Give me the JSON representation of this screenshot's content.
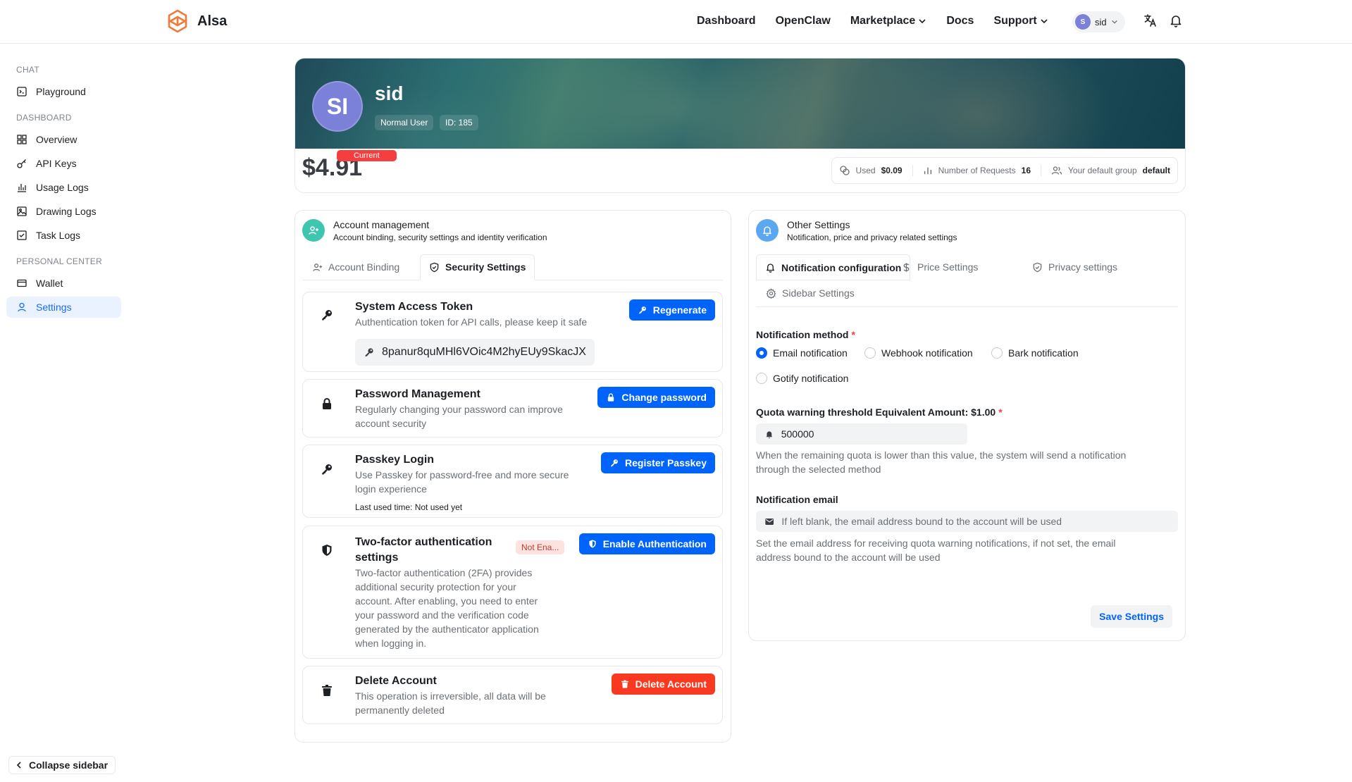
{
  "header": {
    "brand": "Alsa",
    "nav": [
      {
        "label": "Dashboard"
      },
      {
        "label": "OpenClaw"
      },
      {
        "label": "Marketplace"
      },
      {
        "label": "Docs"
      },
      {
        "label": "Support"
      }
    ],
    "user": {
      "initial": "S",
      "name": "sid"
    }
  },
  "sidebar": {
    "sections": {
      "chat": "CHAT",
      "dashboard": "DASHBOARD",
      "personal": "PERSONAL CENTER"
    },
    "items": {
      "playground": "Playground",
      "overview": "Overview",
      "api_keys": "API Keys",
      "usage_logs": "Usage Logs",
      "drawing_logs": "Drawing Logs",
      "task_logs": "Task Logs",
      "wallet": "Wallet",
      "settings": "Settings"
    },
    "collapse": "Collapse sidebar"
  },
  "profile": {
    "initials": "SI",
    "name": "sid",
    "role": "Normal User",
    "id": "ID: 185",
    "balance": "$4.91",
    "current_badge": "Current",
    "stats": {
      "used_label": "Used",
      "used_value": "$0.09",
      "requests_label": "Number of Requests",
      "requests_value": "16",
      "group_label": "Your default group",
      "group_value": "default"
    }
  },
  "account": {
    "title": "Account management",
    "subtitle": "Account binding, security settings and identity verification",
    "tabs": {
      "binding": "Account Binding",
      "security": "Security Settings"
    },
    "token": {
      "title": "System Access Token",
      "desc": "Authentication token for API calls, please keep it safe",
      "button": "Regenerate",
      "value": "8panur8quMHl6VOic4M2hyEUy9SkacJX"
    },
    "password": {
      "title": "Password Management",
      "desc1": "Regularly changing your password can improve",
      "desc2": "account security",
      "button": "Change password"
    },
    "passkey": {
      "title": "Passkey Login",
      "desc1": "Use Passkey for password-free and more secure",
      "desc2": "login experience",
      "last_used": "Last used time:  Not used yet",
      "button": "Register Passkey"
    },
    "twofa": {
      "title1": "Two-factor authentication",
      "title2": "settings",
      "status": "Not Ena...",
      "desc": [
        "Two-factor authentication (2FA) provides",
        "additional security protection for your",
        "account. After enabling, you need to enter",
        "your password and the verification code",
        "generated by the authenticator application",
        "when logging in."
      ],
      "button": "Enable Authentication"
    },
    "delete": {
      "title": "Delete Account",
      "desc1": "This operation is irreversible, all data will be",
      "desc2": "permanently deleted",
      "button": "Delete Account"
    }
  },
  "other": {
    "title": "Other Settings",
    "subtitle": "Notification, price and privacy related settings",
    "tabs": {
      "notification": "Notification configuration",
      "price": "Price Settings",
      "privacy": "Privacy settings",
      "sidebar": "Sidebar Settings"
    },
    "method_label": "Notification method",
    "methods": {
      "email": "Email notification",
      "webhook": "Webhook notification",
      "bark": "Bark notification",
      "gotify": "Gotify notification"
    },
    "selected_method": "email",
    "quota_label": "Quota warning threshold Equivalent Amount: $1.00",
    "quota_value": "500000",
    "quota_help1": "When the remaining quota is lower than this value, the system will send a notification",
    "quota_help2": "through the selected method",
    "email_label": "Notification email",
    "email_placeholder": "If left blank, the email address bound to the account will be used",
    "email_help1": "Set the email address for receiving quota warning notifications, if not set, the email",
    "email_help2": "address bound to the account will be used",
    "save": "Save Settings"
  },
  "colors": {
    "primary": "#0064fa",
    "danger": "#f93920",
    "active_bg": "#eaf2ff",
    "avatar": "#7b80d8"
  }
}
